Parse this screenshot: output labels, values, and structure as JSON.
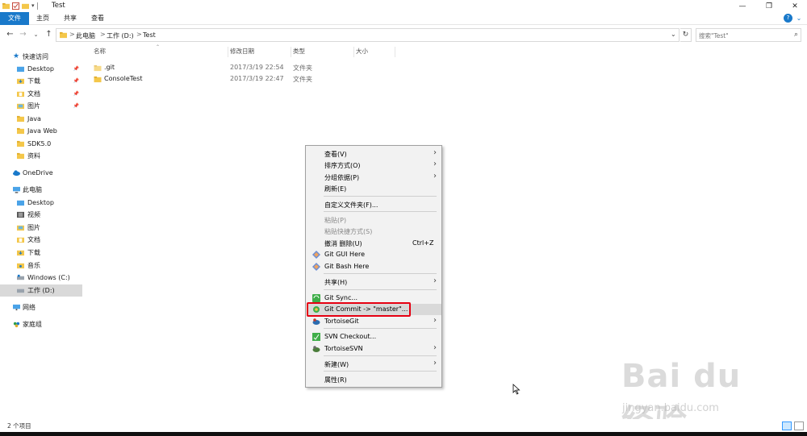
{
  "window": {
    "title": "Test",
    "controls": {
      "minimize": "—",
      "maximize": "❐",
      "close": "✕"
    }
  },
  "ribbon": {
    "tabs": [
      {
        "label": "文件",
        "active": true
      },
      {
        "label": "主页"
      },
      {
        "label": "共享"
      },
      {
        "label": "查看"
      }
    ],
    "help": "?",
    "expand": "⌄"
  },
  "address": {
    "crumbs": [
      "此电脑",
      "工作 (D:)",
      "Test"
    ],
    "separator": ">",
    "search_placeholder": "搜索\"Test\""
  },
  "sidebar": {
    "items": [
      {
        "label": "快速访问",
        "icon": "star-icon",
        "level": 0,
        "pinned": false
      },
      {
        "label": "Desktop",
        "icon": "desktop-folder-icon",
        "level": 1,
        "pinned": true
      },
      {
        "label": "下载",
        "icon": "download-folder-icon",
        "level": 1,
        "pinned": true
      },
      {
        "label": "文档",
        "icon": "documents-folder-icon",
        "level": 1,
        "pinned": true
      },
      {
        "label": "图片",
        "icon": "pictures-folder-icon",
        "level": 1,
        "pinned": true
      },
      {
        "label": "Java",
        "icon": "folder-icon",
        "level": 1,
        "pinned": false
      },
      {
        "label": "Java Web",
        "icon": "folder-icon",
        "level": 1,
        "pinned": false
      },
      {
        "label": "SDK5.0",
        "icon": "folder-icon",
        "level": 1,
        "pinned": false
      },
      {
        "label": "资料",
        "icon": "folder-icon",
        "level": 1,
        "pinned": false
      },
      {
        "label": "OneDrive",
        "icon": "cloud-icon",
        "level": 0,
        "pinned": false
      },
      {
        "label": "此电脑",
        "icon": "computer-icon",
        "level": 0,
        "pinned": false
      },
      {
        "label": "Desktop",
        "icon": "desktop-folder-icon",
        "level": 1,
        "pinned": false
      },
      {
        "label": "视频",
        "icon": "videos-folder-icon",
        "level": 1,
        "pinned": false
      },
      {
        "label": "图片",
        "icon": "pictures-folder-icon",
        "level": 1,
        "pinned": false
      },
      {
        "label": "文档",
        "icon": "documents-folder-icon",
        "level": 1,
        "pinned": false
      },
      {
        "label": "下载",
        "icon": "download-folder-icon",
        "level": 1,
        "pinned": false
      },
      {
        "label": "音乐",
        "icon": "music-folder-icon",
        "level": 1,
        "pinned": false
      },
      {
        "label": "Windows (C:)",
        "icon": "drive-icon",
        "level": 1,
        "pinned": false
      },
      {
        "label": "工作 (D:)",
        "icon": "drive-icon",
        "level": 1,
        "pinned": false,
        "selected": true
      },
      {
        "label": "网络",
        "icon": "network-icon",
        "level": 0,
        "pinned": false
      },
      {
        "label": "家庭组",
        "icon": "homegroup-icon",
        "level": 0,
        "pinned": false
      }
    ]
  },
  "files": {
    "columns": [
      "名称",
      "修改日期",
      "类型",
      "大小"
    ],
    "rows": [
      {
        "name": ".git",
        "date": "2017/3/19 22:54",
        "type": "文件夹",
        "size": ""
      },
      {
        "name": "ConsoleTest",
        "date": "2017/3/19 22:47",
        "type": "文件夹",
        "size": ""
      }
    ]
  },
  "status": {
    "count": "2 个项目"
  },
  "context_menu": {
    "items": [
      {
        "label": "查看(V)",
        "submenu": true
      },
      {
        "label": "排序方式(O)",
        "submenu": true
      },
      {
        "label": "分组依据(P)",
        "submenu": true
      },
      {
        "label": "刷新(E)"
      },
      {
        "sep": true
      },
      {
        "label": "自定义文件夹(F)..."
      },
      {
        "sep": true
      },
      {
        "label": "粘贴(P)",
        "disabled": true
      },
      {
        "label": "粘贴快捷方式(S)",
        "disabled": true
      },
      {
        "label": "撤消 删除(U)",
        "shortcut": "Ctrl+Z"
      },
      {
        "label": "Git GUI Here",
        "icon": "git-gui-icon"
      },
      {
        "label": "Git Bash Here",
        "icon": "git-bash-icon"
      },
      {
        "sep": true
      },
      {
        "label": "共享(H)",
        "submenu": true
      },
      {
        "sep": true
      },
      {
        "label": "Git Sync...",
        "icon": "git-sync-icon"
      },
      {
        "label": "Git Commit -> \"master\"...",
        "icon": "git-commit-icon",
        "highlighted": true
      },
      {
        "label": "TortoiseGit",
        "icon": "tortoisegit-icon",
        "submenu": true
      },
      {
        "sep": true
      },
      {
        "label": "SVN Checkout...",
        "icon": "svn-checkout-icon"
      },
      {
        "label": "TortoiseSVN",
        "icon": "tortoisesvn-icon",
        "submenu": true
      },
      {
        "sep": true
      },
      {
        "label": "新建(W)",
        "submenu": true
      },
      {
        "sep": true
      },
      {
        "label": "属性(R)"
      }
    ]
  },
  "watermark": {
    "brand": "Bai du 经验",
    "url": "jingyan.baidu.com"
  },
  "colors": {
    "accent": "#1979ca",
    "selection": "#d9d9d9",
    "highlight_box": "#e60012",
    "folder": "#f4c74a"
  }
}
